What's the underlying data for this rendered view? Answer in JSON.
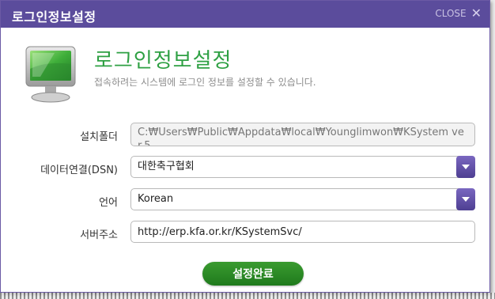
{
  "window": {
    "title": "로그인정보설정",
    "close_label": "CLOSE",
    "close_glyph": "✕"
  },
  "header": {
    "icon": "monitor-icon",
    "heading": "로그인정보설정",
    "subtitle": "접속하려는 시스템에 로그인 정보를 설정할 수 있습니다."
  },
  "form": {
    "install_folder": {
      "label": "설치폴더",
      "value": "C:₩Users₩Public₩Appdata₩local₩Younglimwon₩KSystem ver.5"
    },
    "dsn": {
      "label": "데이터연결(DSN)",
      "value": "대한축구협회"
    },
    "language": {
      "label": "언어",
      "value": "Korean"
    },
    "server": {
      "label": "서버주소",
      "value": "http://erp.kfa.or.kr/KSystemSvc/"
    }
  },
  "submit_label": "설정완료",
  "colors": {
    "titlebar": "#5b4c9c",
    "heading": "#2ea043",
    "dropdown": "#5b4c9c",
    "submit": "#2a8a24"
  }
}
